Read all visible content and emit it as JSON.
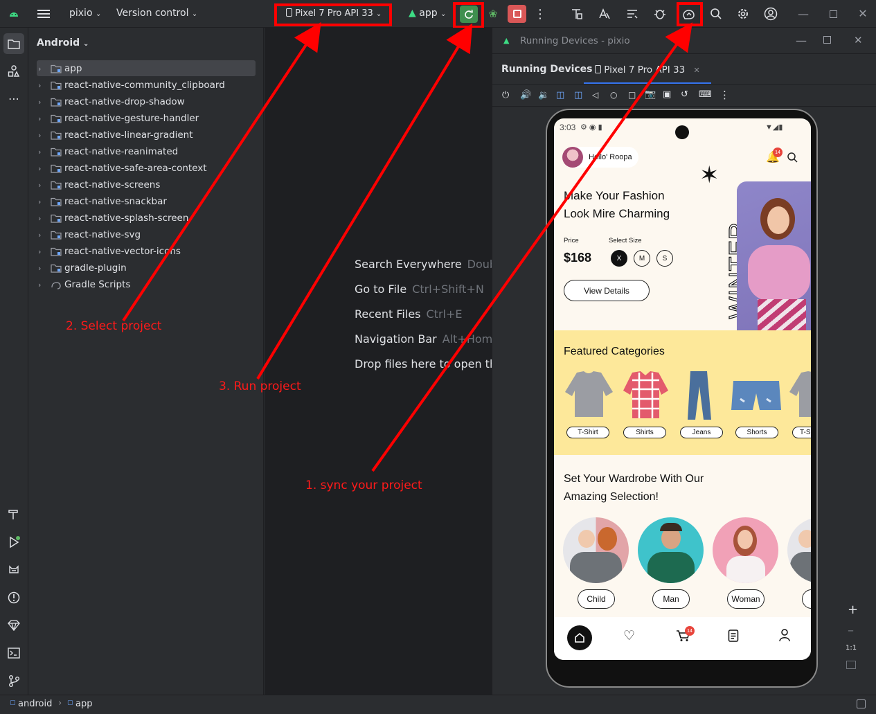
{
  "toolbar": {
    "project": "pixio",
    "vcs": "Version control",
    "device": "Pixel 7 Pro API 33",
    "run_config": "app"
  },
  "project_panel": {
    "title": "Android",
    "items": [
      "app",
      "react-native-community_clipboard",
      "react-native-drop-shadow",
      "react-native-gesture-handler",
      "react-native-linear-gradient",
      "react-native-reanimated",
      "react-native-safe-area-context",
      "react-native-screens",
      "react-native-snackbar",
      "react-native-splash-screen",
      "react-native-svg",
      "react-native-vector-icons",
      "gradle-plugin",
      "Gradle Scripts"
    ]
  },
  "editor": {
    "hints": [
      {
        "label": "Search Everywhere",
        "key": "Double Shift"
      },
      {
        "label": "Go to File",
        "key": "Ctrl+Shift+N"
      },
      {
        "label": "Recent Files",
        "key": "Ctrl+E"
      },
      {
        "label": "Navigation Bar",
        "key": "Alt+Home"
      },
      {
        "label": "Drop files here to open them",
        "key": ""
      }
    ]
  },
  "running_devices": {
    "window_title": "Running Devices - pixio",
    "tab_title": "Running Devices",
    "device_tab": "Pixel 7 Pro API 33",
    "zoom": "1:1"
  },
  "phone": {
    "time": "3:03",
    "greeting": "Hello' Roopa",
    "notif_count": "14",
    "hero_line1": "Make Your Fashion",
    "hero_line2": "Look Mire Charming",
    "price_label": "Price",
    "price": "$168",
    "size_label": "Select Size",
    "sizes": [
      "X",
      "M",
      "S"
    ],
    "view_details": "View Details",
    "season": "WINTER",
    "featured_title": "Featured Categories",
    "categories": [
      "T-Shirt",
      "Shirts",
      "Jeans",
      "Shorts",
      "T-S"
    ],
    "wardrobe_line1": "Set Your Wardrobe With Our",
    "wardrobe_line2": "Amazing Selection!",
    "people": [
      "Child",
      "Man",
      "Woman"
    ],
    "cart_count": "14"
  },
  "annotations": {
    "select": "2. Select project",
    "run": "3. Run project",
    "sync": "1. sync your project"
  },
  "status": {
    "crumb1": "android",
    "crumb2": "app"
  },
  "colors": {
    "accent_red": "#ff0000",
    "run_green": "#3f8f4f",
    "stop_red": "#d95757",
    "featured_bg": "#fde89a"
  }
}
